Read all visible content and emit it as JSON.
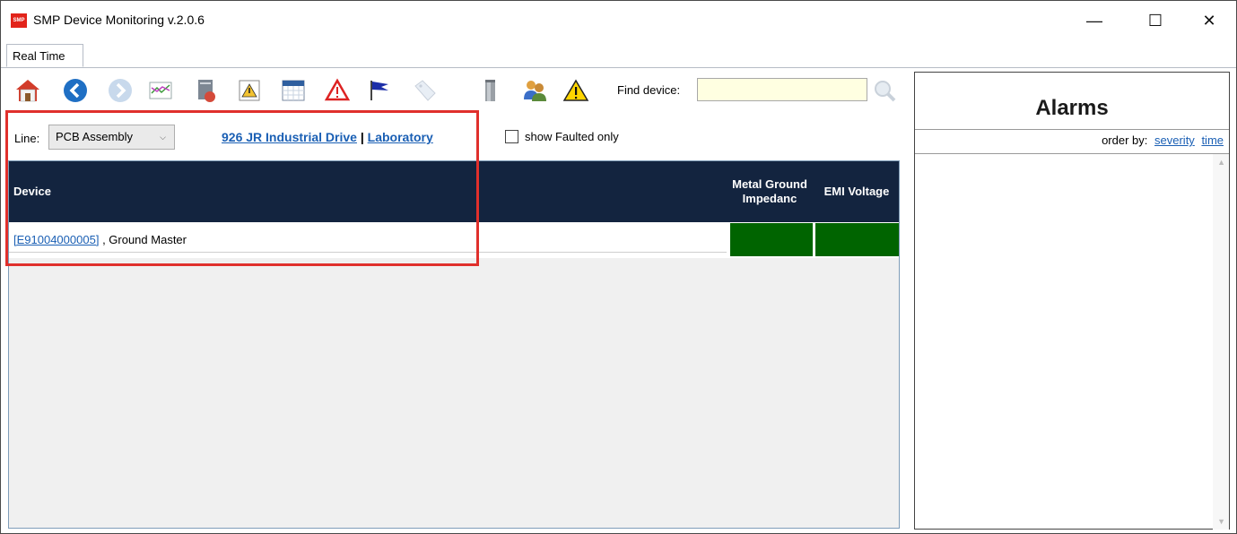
{
  "window": {
    "logo_text": "SMP",
    "title": "SMP Device Monitoring v.2.0.6",
    "minimize": "—",
    "maximize": "☐",
    "close": "✕"
  },
  "tabs": [
    {
      "label": "Real Time",
      "active": true
    }
  ],
  "toolbar": {
    "icons": [
      "home-icon",
      "back-icon",
      "forward-icon",
      "trend-chart-icon",
      "report-icon",
      "alert-report-icon",
      "calendar-icon",
      "alarm-triangle-icon",
      "flag-icon",
      "tag-icon",
      "device-icon",
      "users-icon",
      "warning-icon"
    ],
    "find_label": "Find device:",
    "find_value": "",
    "search_icon": "search-icon"
  },
  "filter": {
    "line_label": "Line:",
    "line_value": "PCB Assembly",
    "location_1": "926 JR Industrial Drive",
    "separator": "|",
    "location_2": "Laboratory",
    "show_faulted_label": "show Faulted only",
    "show_faulted_checked": false
  },
  "grid": {
    "headers": {
      "device": "Device",
      "metal_ground": "Metal Ground Impedanc",
      "emi": "EMI Voltage"
    },
    "rows": [
      {
        "device_id": "[E91004000005]",
        "device_name": ", Ground Master",
        "metal_ground_status": "#006400",
        "emi_status": "#006400"
      }
    ]
  },
  "alarms": {
    "title": "Alarms",
    "order_by_label": "order by:",
    "order_severity": "severity",
    "order_time": "time"
  },
  "colors": {
    "header_bg": "#13243f",
    "status_ok": "#006400",
    "highlight": "#e0302c",
    "link": "#1a5fb4"
  }
}
